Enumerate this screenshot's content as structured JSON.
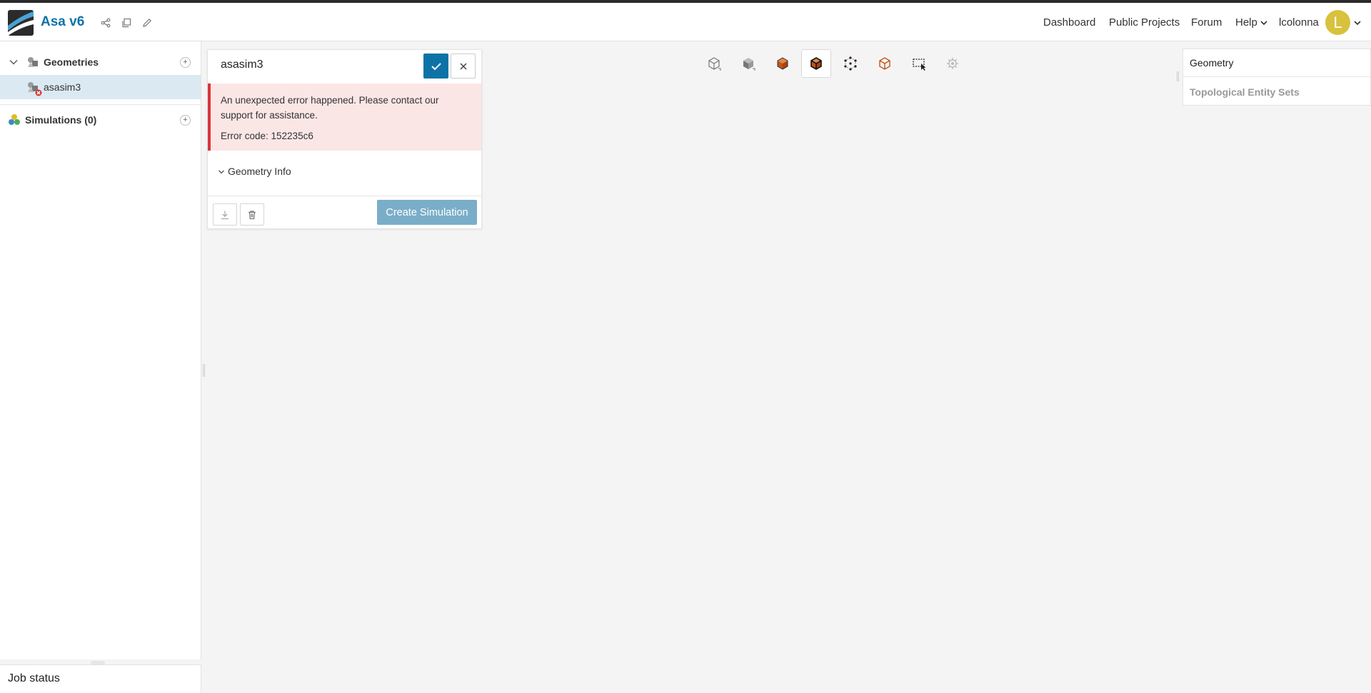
{
  "header": {
    "app_title": "Asa v6",
    "nav": {
      "dashboard": "Dashboard",
      "public_projects": "Public Projects",
      "forum": "Forum",
      "help": "Help",
      "username": "lcolonna"
    },
    "avatar_initial": "L",
    "icons": [
      "share-icon",
      "copy-icon",
      "edit-icon"
    ]
  },
  "sidebar": {
    "geometries_label": "Geometries",
    "geometry_item": "asasim3",
    "simulations_label": "Simulations (0)",
    "job_status_label": "Job status"
  },
  "dialog": {
    "title": "asasim3",
    "error_message": "An unexpected error happened. Please contact our support for assistance.",
    "error_code": "Error code: 152235c6",
    "section_label": "Geometry Info",
    "create_button": "Create Simulation"
  },
  "toolbar": {
    "tools": [
      "wireframe-cube-icon",
      "solid-cube-icon",
      "face-select-icon",
      "edge-select-icon",
      "vertex-select-icon",
      "volume-select-icon",
      "box-select-icon",
      "settings-icon"
    ],
    "active_tool": "edge-select-icon"
  },
  "right_panel": {
    "items": [
      "Geometry",
      "Topological Entity Sets"
    ]
  },
  "colors": {
    "brand": "#0d73a6",
    "error_border": "#d9343a",
    "error_bg": "#fbe6e6",
    "avatar": "#d8c13c",
    "highlight_orange": "#c0541a",
    "selection_bg": "#dbeaf2"
  }
}
